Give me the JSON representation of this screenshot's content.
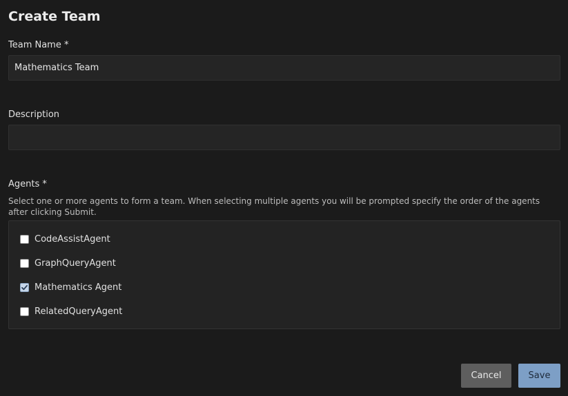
{
  "dialog": {
    "title": "Create Team",
    "team_name": {
      "label": "Team Name *",
      "value": "Mathematics Team",
      "placeholder": ""
    },
    "description": {
      "label": "Description",
      "value": "",
      "placeholder": ""
    },
    "agents": {
      "label": "Agents *",
      "help": "Select one or more agents to form a team. When selecting multiple agents you will be prompted specify the order of the agents after clicking Submit.",
      "items": [
        {
          "label": "CodeAssistAgent",
          "checked": false
        },
        {
          "label": "GraphQueryAgent",
          "checked": false
        },
        {
          "label": "Mathematics Agent",
          "checked": true
        },
        {
          "label": "RelatedQueryAgent",
          "checked": false
        }
      ]
    },
    "buttons": {
      "cancel": "Cancel",
      "save": "Save"
    }
  }
}
